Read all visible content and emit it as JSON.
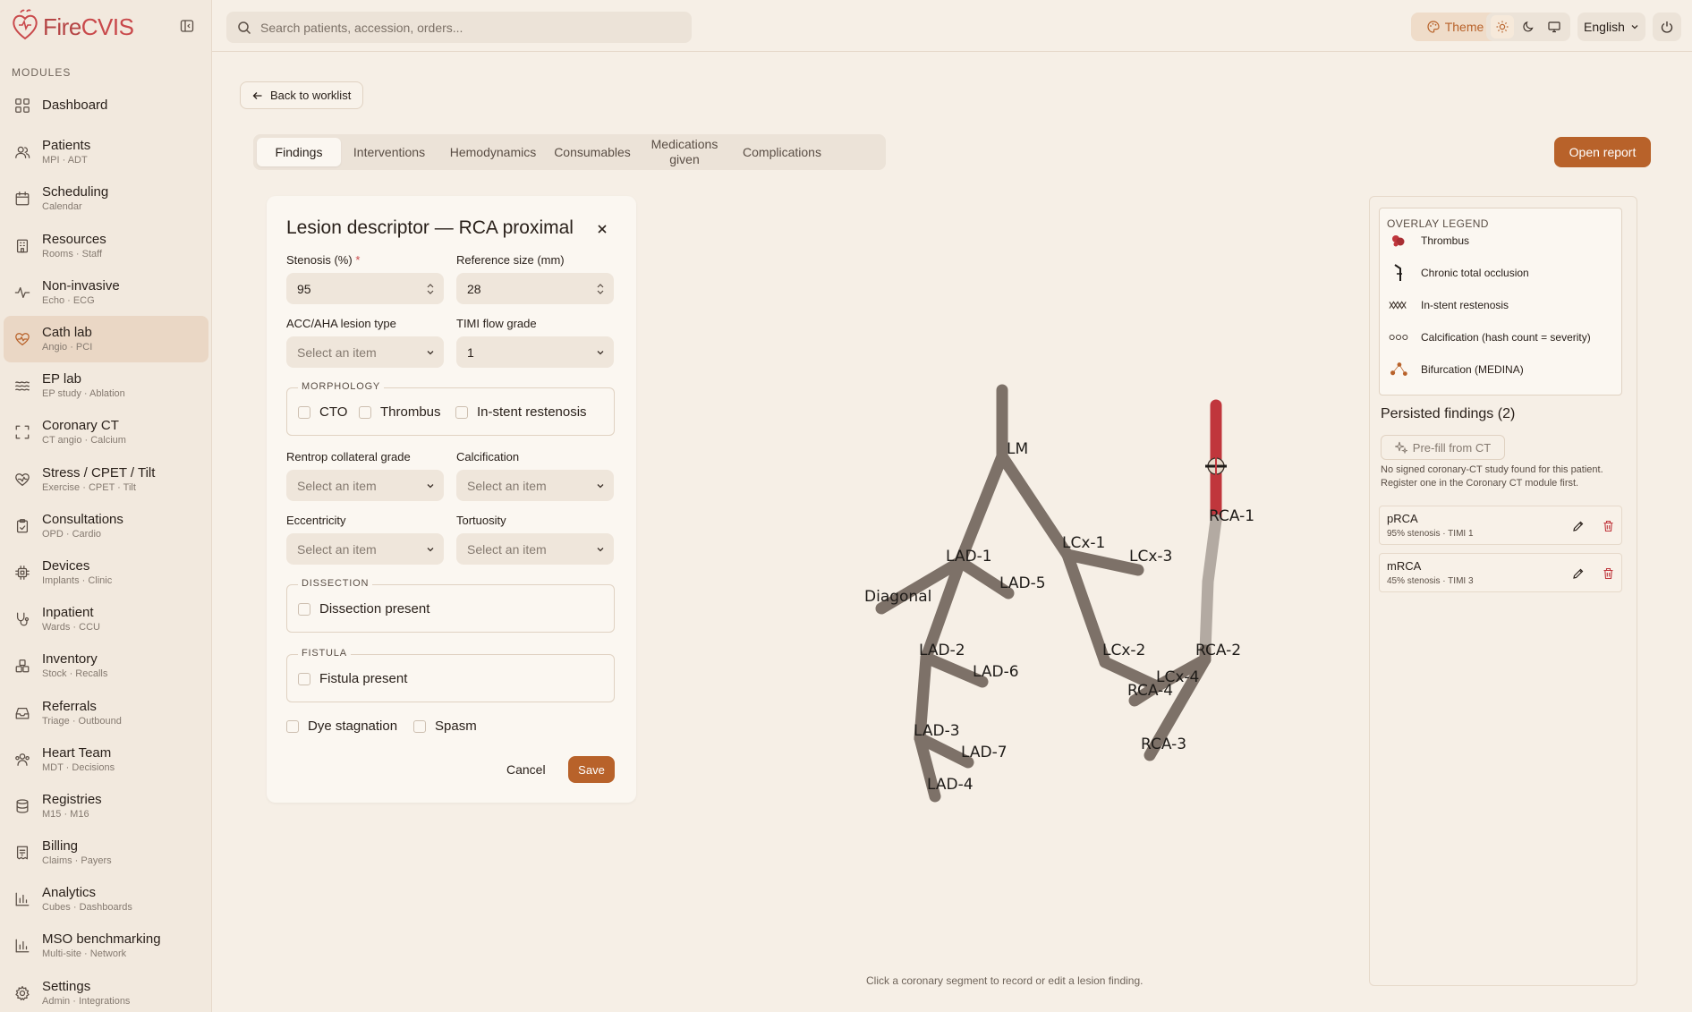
{
  "app": {
    "brand_prefix": "Fire",
    "brand_suffix": "CVIS"
  },
  "sidebar": {
    "section_label": "MODULES",
    "items": [
      {
        "label": "Dashboard",
        "sub": "",
        "icon": "dashboard-icon"
      },
      {
        "label": "Patients",
        "sub": "MPI · ADT",
        "icon": "users-icon"
      },
      {
        "label": "Scheduling",
        "sub": "Calendar",
        "icon": "calendar-icon"
      },
      {
        "label": "Resources",
        "sub": "Rooms · Staff",
        "icon": "building-icon"
      },
      {
        "label": "Non-invasive",
        "sub": "Echo · ECG",
        "icon": "pulse-icon"
      },
      {
        "label": "Cath lab",
        "sub": "Angio · PCI",
        "icon": "heart-pulse-icon"
      },
      {
        "label": "EP lab",
        "sub": "EP study · Ablation",
        "icon": "waves-icon"
      },
      {
        "label": "Coronary CT",
        "sub": "CT angio · Calcium",
        "icon": "scan-icon"
      },
      {
        "label": "Stress / CPET / Tilt",
        "sub": "Exercise · CPET · Tilt",
        "icon": "heart-activity-icon"
      },
      {
        "label": "Consultations",
        "sub": "OPD · Cardio",
        "icon": "clipboard-icon"
      },
      {
        "label": "Devices",
        "sub": "Implants · Clinic",
        "icon": "chip-icon"
      },
      {
        "label": "Inpatient",
        "sub": "Wards · CCU",
        "icon": "stethoscope-icon"
      },
      {
        "label": "Inventory",
        "sub": "Stock · Recalls",
        "icon": "boxes-icon"
      },
      {
        "label": "Referrals",
        "sub": "Triage · Outbound",
        "icon": "inbox-icon"
      },
      {
        "label": "Heart Team",
        "sub": "MDT · Decisions",
        "icon": "team-icon"
      },
      {
        "label": "Registries",
        "sub": "M15 · M16",
        "icon": "database-icon"
      },
      {
        "label": "Billing",
        "sub": "Claims · Payers",
        "icon": "receipt-icon"
      },
      {
        "label": "Analytics",
        "sub": "Cubes · Dashboards",
        "icon": "bar-chart-icon"
      },
      {
        "label": "MSO benchmarking",
        "sub": "Multi-site · Network",
        "icon": "bar-chart-icon"
      },
      {
        "label": "Settings",
        "sub": "Admin · Integrations",
        "icon": "gear-icon"
      }
    ],
    "active_index": 5
  },
  "topbar": {
    "search_placeholder": "Search patients, accession, orders...",
    "theme_label": "Theme",
    "language": "English"
  },
  "main": {
    "back_label": "Back to worklist",
    "tabs": [
      {
        "label": "Findings"
      },
      {
        "label": "Interventions"
      },
      {
        "label": "Hemodynamics"
      },
      {
        "label": "Consumables"
      },
      {
        "label": "Medications given"
      },
      {
        "label": "Complications"
      }
    ],
    "active_tab": 0,
    "open_report_label": "Open report",
    "hint": "Click a coronary segment to record or edit a lesion finding."
  },
  "dialog": {
    "title": "Lesion descriptor — RCA proximal",
    "stenosis_label": "Stenosis (%)",
    "stenosis_required": "*",
    "stenosis_value": "95",
    "reference_label": "Reference size (mm)",
    "reference_value": "28",
    "lesion_type_label": "ACC/AHA lesion type",
    "lesion_type_value": "Select an item",
    "timi_label": "TIMI flow grade",
    "timi_value": "1",
    "morphology_legend": "MORPHOLOGY",
    "morphology_options": [
      "CTO",
      "Thrombus",
      "In-stent restenosis"
    ],
    "rentrop_label": "Rentrop collateral grade",
    "rentrop_value": "Select an item",
    "calcification_label": "Calcification",
    "calcification_value": "Select an item",
    "eccentricity_label": "Eccentricity",
    "eccentricity_value": "Select an item",
    "tortuosity_label": "Tortuosity",
    "tortuosity_value": "Select an item",
    "dissection_legend": "DISSECTION",
    "dissection_option": "Dissection present",
    "fistula_legend": "FISTULA",
    "fistula_option": "Fistula present",
    "dye_stagnation": "Dye stagnation",
    "spasm": "Spasm",
    "cancel_label": "Cancel",
    "save_label": "Save"
  },
  "tree": {
    "labels": {
      "lm": "LM",
      "lad1": "LAD-1",
      "lad2": "LAD-2",
      "lad3": "LAD-3",
      "lad4": "LAD-4",
      "lad5": "LAD-5",
      "lad6": "LAD-6",
      "lad7": "LAD-7",
      "diag": "Diagonal",
      "lcx1": "LCx-1",
      "lcx2": "LCx-2",
      "lcx3": "LCx-3",
      "lcx4": "LCx-4",
      "rca1": "RCA-1",
      "rca2": "RCA-2",
      "rca3": "RCA-3",
      "rca4": "RCA-4"
    },
    "vessel_color": "#7d7168",
    "highlight_color": "#c0363c"
  },
  "right_panel": {
    "legend_title": "OVERLAY LEGEND",
    "legend_items": [
      {
        "label": "Thrombus",
        "icon": "thrombus-icon"
      },
      {
        "label": "Chronic total occlusion",
        "icon": "occlusion-icon"
      },
      {
        "label": "In-stent restenosis",
        "icon": "stent-icon"
      },
      {
        "label": "Calcification (hash count = severity)",
        "icon": "calcification-icon"
      },
      {
        "label": "Bifurcation (MEDINA)",
        "icon": "bifurcation-icon"
      }
    ],
    "persisted_title": "Persisted findings (2)",
    "prefill_label": "Pre-fill from CT",
    "note": "No signed coronary-CT study found for this patient. Register one in the Coronary CT module first.",
    "findings": [
      {
        "name": "pRCA",
        "sub": "95% stenosis · TIMI 1"
      },
      {
        "name": "mRCA",
        "sub": "45% stenosis · TIMI 3"
      }
    ]
  }
}
